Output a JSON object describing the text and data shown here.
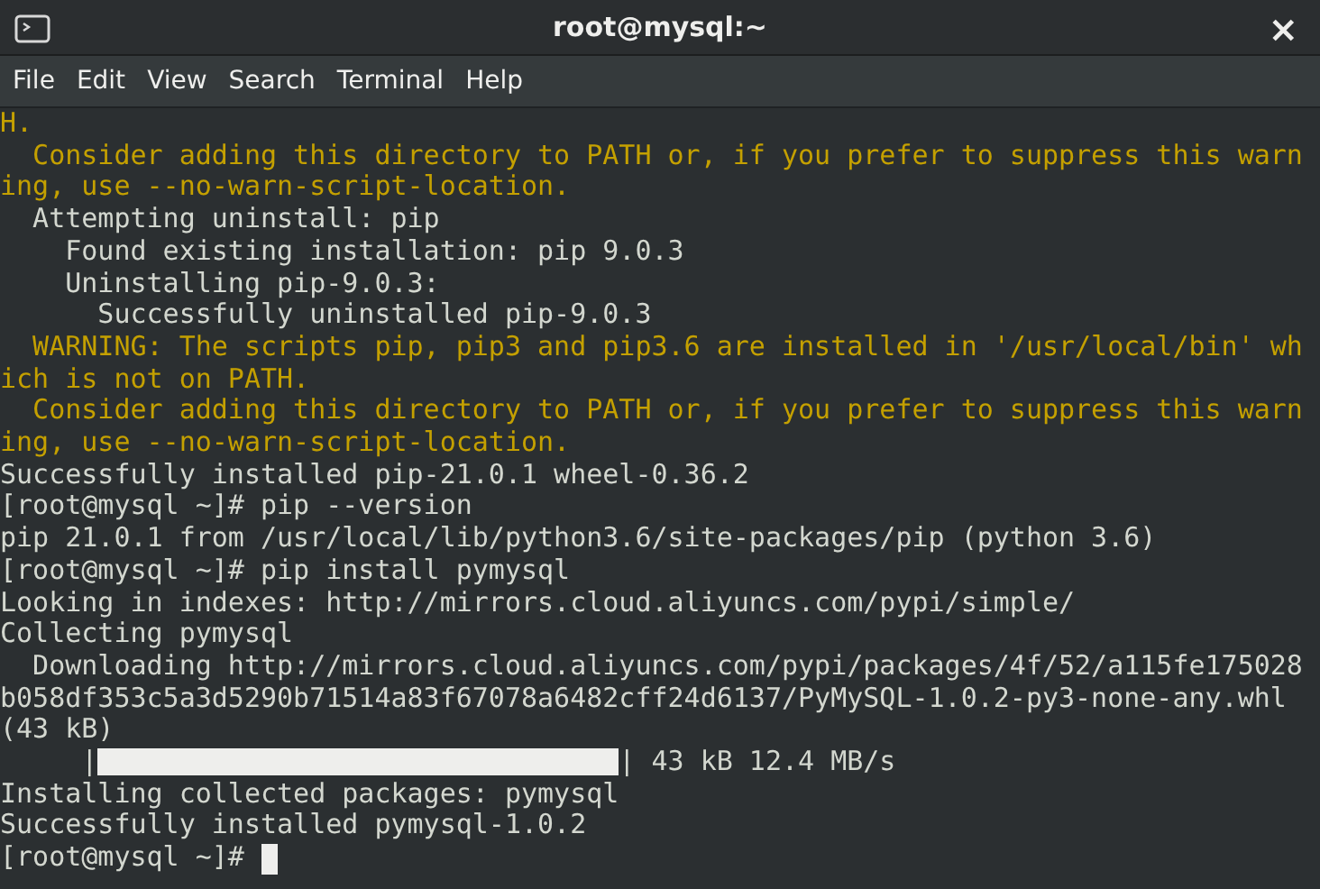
{
  "window": {
    "title": "root@mysql:~",
    "close": "×"
  },
  "menu": [
    "File",
    "Edit",
    "View",
    "Search",
    "Terminal",
    "Help"
  ],
  "terminal": {
    "lines": [
      {
        "kind": "warning",
        "text": "H."
      },
      {
        "kind": "warning",
        "text": "  Consider adding this directory to PATH or, if you prefer to suppress this warn"
      },
      {
        "kind": "warning",
        "text": "ing, use --no-warn-script-location."
      },
      {
        "kind": "output",
        "text": "  Attempting uninstall: pip"
      },
      {
        "kind": "output",
        "text": "    Found existing installation: pip 9.0.3"
      },
      {
        "kind": "output",
        "text": "    Uninstalling pip-9.0.3:"
      },
      {
        "kind": "output",
        "text": "      Successfully uninstalled pip-9.0.3"
      },
      {
        "kind": "warning",
        "text": "  WARNING: The scripts pip, pip3 and pip3.6 are installed in '/usr/local/bin' wh"
      },
      {
        "kind": "warning",
        "text": "ich is not on PATH."
      },
      {
        "kind": "warning",
        "text": "  Consider adding this directory to PATH or, if you prefer to suppress this warn"
      },
      {
        "kind": "warning",
        "text": "ing, use --no-warn-script-location."
      },
      {
        "kind": "output",
        "text": "Successfully installed pip-21.0.1 wheel-0.36.2"
      },
      {
        "kind": "output",
        "text": "[root@mysql ~]# pip --version"
      },
      {
        "kind": "output",
        "text": "pip 21.0.1 from /usr/local/lib/python3.6/site-packages/pip (python 3.6)"
      },
      {
        "kind": "output",
        "text": "[root@mysql ~]# pip install pymysql"
      },
      {
        "kind": "output",
        "text": "Looking in indexes: http://mirrors.cloud.aliyuncs.com/pypi/simple/"
      },
      {
        "kind": "output",
        "text": "Collecting pymysql"
      },
      {
        "kind": "output",
        "text": "  Downloading http://mirrors.cloud.aliyuncs.com/pypi/packages/4f/52/a115fe175028"
      },
      {
        "kind": "output",
        "text": "b058df353c5a3d5290b71514a83f67078a6482cff24d6137/PyMySQL-1.0.2-py3-none-any.whl"
      },
      {
        "kind": "output",
        "text": "(43 kB)"
      },
      {
        "kind": "progress",
        "before": "     |",
        "after": "| 43 kB 12.4 MB/s",
        "level": 1
      },
      {
        "kind": "output",
        "text": "Installing collected packages: pymysql"
      },
      {
        "kind": "output",
        "text": "Successfully installed pymysql-1.0.2"
      },
      {
        "kind": "prompt",
        "text": "[root@mysql ~]# "
      }
    ]
  }
}
